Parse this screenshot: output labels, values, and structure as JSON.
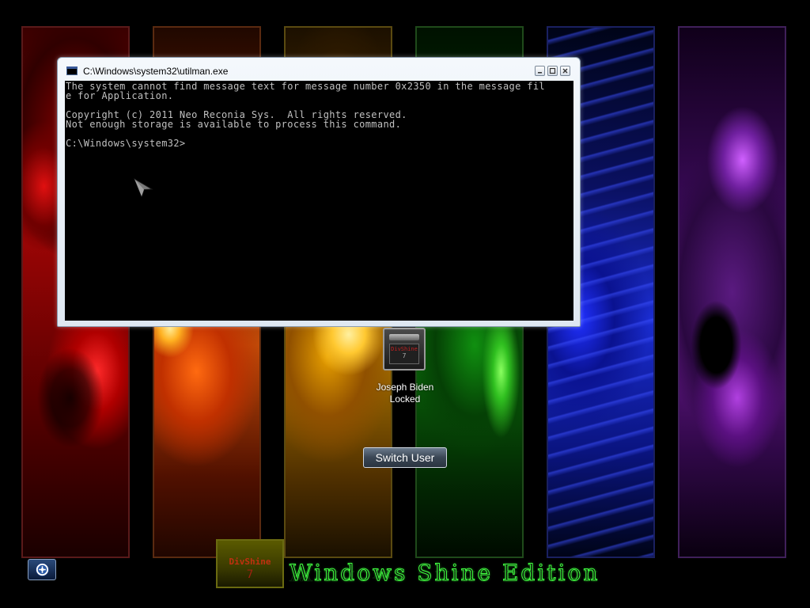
{
  "window": {
    "title": "C:\\Windows\\system32\\utilman.exe",
    "controls": {
      "minimize_icon": "minimize-icon",
      "maximize_icon": "maximize-icon",
      "close_icon": "close-icon"
    },
    "console_lines": [
      "The system cannot find message text for message number 0x2350 in the message fil",
      "e for Application.",
      "",
      "Copyright (c) 2011 Neo Reconia Sys.  All rights reserved.",
      "Not enough storage is available to process this command.",
      "",
      "C:\\Windows\\system32>"
    ]
  },
  "user": {
    "name": "Joseph Biden",
    "status": "Locked",
    "tile_brand": "DivShine",
    "tile_seven": "7"
  },
  "switch_user": {
    "label": "Switch User"
  },
  "ease_of_access": {
    "icon": "ease-of-access-icon"
  },
  "branding": {
    "logo_text": "DivShine",
    "logo_seven": "7",
    "edition": "Windows Shine Edition"
  },
  "colors": {
    "console_text": "#c0c0c0",
    "edition_text": "#40ff40"
  }
}
